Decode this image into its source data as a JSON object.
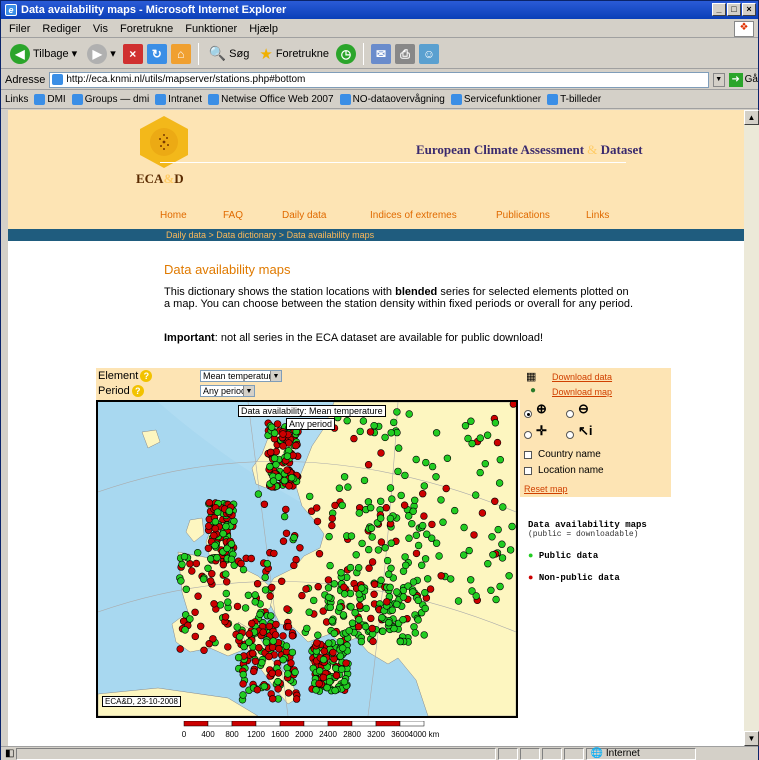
{
  "window": {
    "title": "Data availability maps - Microsoft Internet Explorer"
  },
  "menu": [
    "Filer",
    "Rediger",
    "Vis",
    "Foretrukne",
    "Funktioner",
    "Hjælp"
  ],
  "toolbar": {
    "back": "Tilbage",
    "search": "Søg",
    "favorites": "Foretrukne"
  },
  "address": {
    "label": "Adresse",
    "url": "http://eca.knmi.nl/utils/mapserver/stations.php#bottom",
    "go": "Gå"
  },
  "links": {
    "label": "Links",
    "items": [
      "DMI",
      "Groups — dmi",
      "Intranet",
      "Netwise Office Web 2007",
      "NO-dataovervågning",
      "Servicefunktioner",
      "T-billeder"
    ]
  },
  "site": {
    "logo_pre": "ECA",
    "logo_amp": "&",
    "logo_post": "D",
    "title_pre": "European Climate Assessment ",
    "title_amp": "&",
    "title_post": " Dataset",
    "nav": [
      "Home",
      "FAQ",
      "Daily data",
      "Indices of extremes",
      "Publications",
      "Links"
    ],
    "breadcrumb": "Daily data > Data dictionary > Data availability maps"
  },
  "page": {
    "title": "Data availability maps",
    "intro_a": "This dictionary shows the station locations with ",
    "intro_b": "blended",
    "intro_c": " series for selected elements plotted on a map. You can choose between the station density within fixed periods or overall for any period.",
    "imp_b": "Important",
    "imp_rest": ": not all series in the ECA dataset are available for public download!"
  },
  "controls": {
    "element_label": "Element",
    "element_value": "Mean temperature",
    "period_label": "Period",
    "period_value": "Any period",
    "download_data": "Download data",
    "download_map": "Download map",
    "country_name": "Country name",
    "location_name": "Location name",
    "reset": "Reset map"
  },
  "map": {
    "tip1": "Data availability: Mean temperature",
    "tip2": "Any period",
    "stamp": "ECA&D, 23-10-2008"
  },
  "legend": {
    "title": "Data availability maps",
    "sub": "(public = downloadable)",
    "public": "Public data",
    "nonpublic": "Non-public data",
    "public_color": "#22cc22",
    "nonpublic_color": "#cc0000"
  },
  "scale": {
    "labels": [
      "0",
      "400",
      "800",
      "1200",
      "1600",
      "2000",
      "2400",
      "2800",
      "3200",
      "3600",
      "4000 km"
    ]
  },
  "status": {
    "zone": "Internet"
  }
}
